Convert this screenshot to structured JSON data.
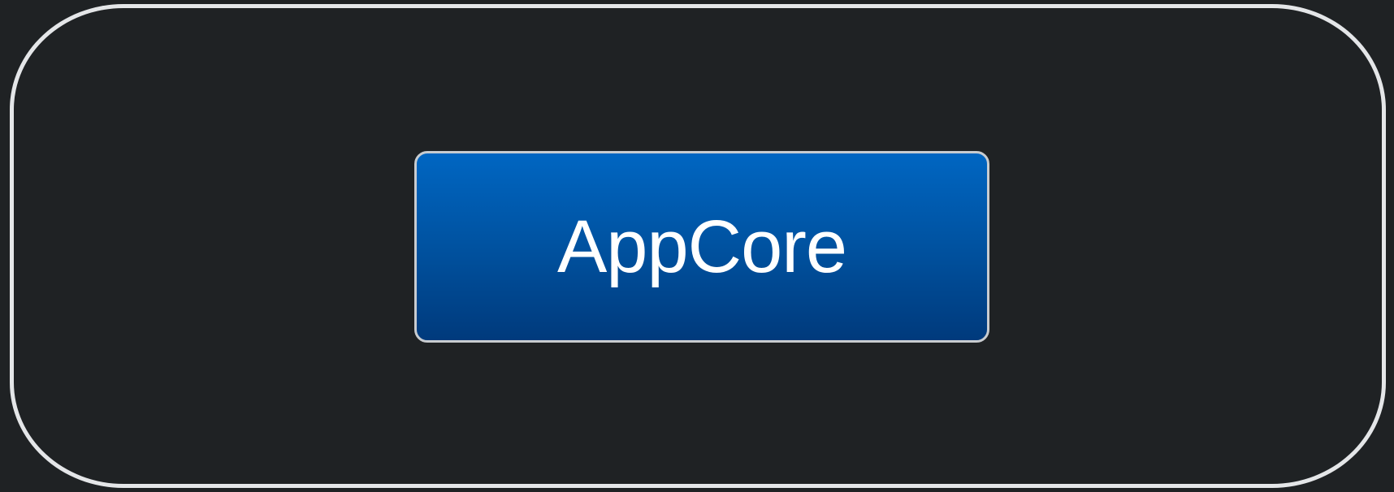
{
  "diagram": {
    "colors": {
      "background": "#1f2224",
      "frame_border": "#e4e6e8",
      "node_fill_top": "#0066c2",
      "node_fill_bottom": "#003a7c",
      "node_border": "#c8ccd0",
      "node_text": "#ffffff"
    },
    "node": {
      "label": "AppCore"
    }
  }
}
